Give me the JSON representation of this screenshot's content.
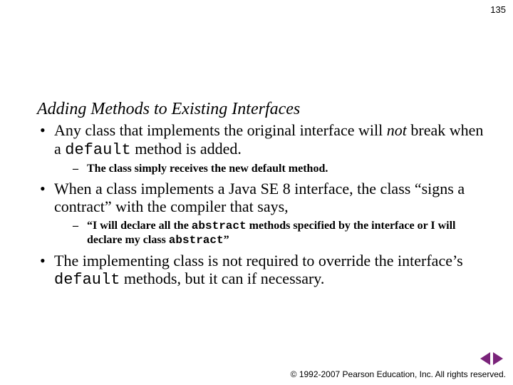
{
  "page_number": "135",
  "heading": "Adding Methods to Existing Interfaces",
  "bullets": [
    {
      "pre": "Any class that implements the original interface will ",
      "em": "not",
      "post": " break when a ",
      "mono": "default",
      "tail": " method is added.",
      "sub": [
        "The class simply receives the new default method."
      ]
    },
    {
      "text": "When a class implements a Java SE 8 interface, the class “signs a contract” with the compiler that says,",
      "sub_rich": {
        "a": "“I will declare all the ",
        "m1": "abstract",
        "b": " methods specified by the interface or I will declare my class ",
        "m2": "abstract",
        "c": "”"
      }
    },
    {
      "pre2": "The implementing class is not required to override the interface’s ",
      "mono2": "default",
      "tail2": " methods, but it can if necessary."
    }
  ],
  "footer": "© 1992-2007 Pearson Education, Inc.  All rights reserved.",
  "nav": {
    "prev": "previous",
    "next": "next"
  }
}
